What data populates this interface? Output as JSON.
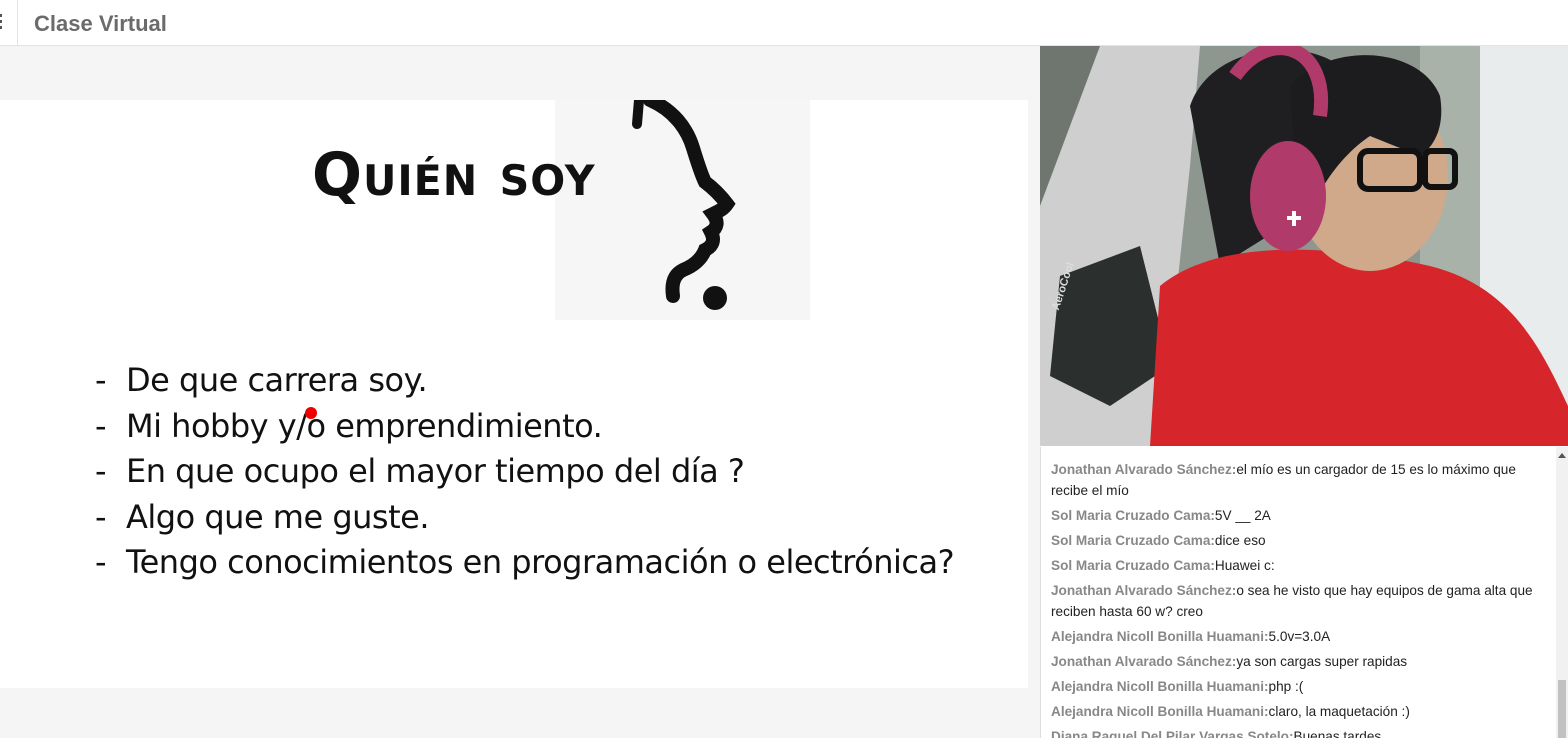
{
  "header": {
    "title": "Clase Virtual"
  },
  "slide": {
    "title": "Quién soy",
    "bullets": [
      "De que carrera soy.",
      "Mi hobby y/o emprendimiento.",
      "En que ocupo el mayor tiempo del día ?",
      "Algo que me guste.",
      "Tengo conocimientos en programación o electrónica?"
    ],
    "bullet_marker": "-"
  },
  "video": {
    "chair_brand": "AeroCool"
  },
  "chat": {
    "messages": [
      {
        "author": "Jonathan Alvarado Sánchez:",
        "text": "el mío es un cargador de 15 es lo máximo que recibe el mío"
      },
      {
        "author": "Sol Maria Cruzado Cama:",
        "text": "5V __ 2A"
      },
      {
        "author": "Sol Maria Cruzado Cama:",
        "text": "dice eso"
      },
      {
        "author": "Sol Maria Cruzado Cama:",
        "text": "Huawei c:"
      },
      {
        "author": "Jonathan Alvarado Sánchez:",
        "text": "o sea he visto que hay equipos de gama alta que reciben hasta 60 w? creo"
      },
      {
        "author": "Alejandra Nicoll Bonilla Huamani:",
        "text": "5.0v=3.0A"
      },
      {
        "author": "Jonathan Alvarado Sánchez:",
        "text": "ya son cargas super rapidas"
      },
      {
        "author": "Alejandra Nicoll Bonilla Huamani:",
        "text": "php :("
      },
      {
        "author": "Alejandra Nicoll Bonilla Huamani:",
        "text": "claro, la maquetación :)"
      },
      {
        "author": "Diana Raquel Del Pilar Vargas Sotelo:",
        "text": "Buenas tardes"
      }
    ]
  },
  "colors": {
    "pointer": "#e00000",
    "author": "#888888",
    "shirt": "#d7262b",
    "headphones": "#b03a6a"
  }
}
